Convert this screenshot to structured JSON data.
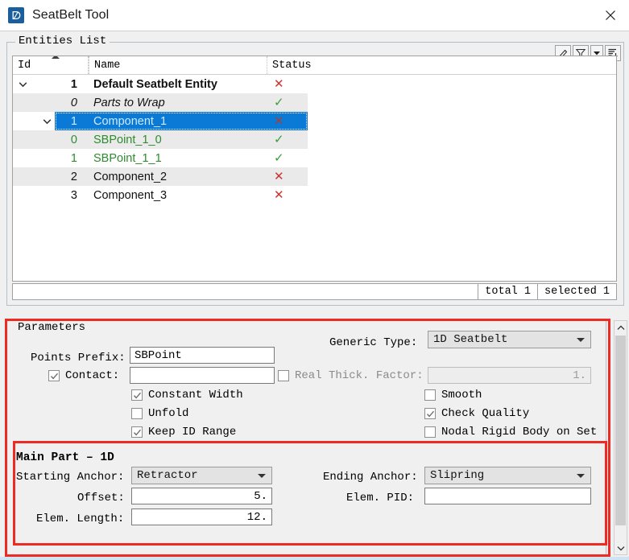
{
  "window": {
    "title": "SeatBelt Tool",
    "icon": "app-logo-icon",
    "close_label": "✕"
  },
  "entities_list": {
    "group_label": "Entities List",
    "toolbar": [
      {
        "name": "eraser-icon",
        "label": ""
      },
      {
        "name": "filter-icon",
        "label": ""
      },
      {
        "name": "filter-dropdown-icon",
        "label": ""
      },
      {
        "name": "sort-list-icon",
        "label": ""
      }
    ],
    "columns": [
      "Id",
      "Name",
      "Status"
    ],
    "rows": [
      {
        "id": "1",
        "name": "Default Seatbelt Entity",
        "status": "x",
        "level": 0,
        "expander": "down",
        "style": "bold",
        "alt": false,
        "selected": false
      },
      {
        "id": "0",
        "name": "Parts to Wrap",
        "status": "v",
        "level": 1,
        "expander": "",
        "style": "italic",
        "alt": true,
        "selected": false
      },
      {
        "id": "1",
        "name": "Component_1",
        "status": "x",
        "level": 1,
        "expander": "down",
        "style": "normal",
        "alt": false,
        "selected": true
      },
      {
        "id": "0",
        "name": "SBPoint_1_0",
        "status": "v",
        "level": 2,
        "expander": "",
        "style": "green",
        "alt": true,
        "selected": false
      },
      {
        "id": "1",
        "name": "SBPoint_1_1",
        "status": "v",
        "level": 2,
        "expander": "",
        "style": "green",
        "alt": false,
        "selected": false
      },
      {
        "id": "2",
        "name": "Component_2",
        "status": "x",
        "level": 1,
        "expander": "",
        "style": "normal",
        "alt": true,
        "selected": false
      },
      {
        "id": "3",
        "name": "Component_3",
        "status": "x",
        "level": 1,
        "expander": "",
        "style": "normal",
        "alt": false,
        "selected": false
      }
    ],
    "status_bar": {
      "total": "total 1",
      "selected": "selected 1"
    }
  },
  "parameters": {
    "group_label": "Parameters",
    "points_prefix_label": "Points Prefix:",
    "points_prefix_value": "SBPoint",
    "contact_label": "Contact:",
    "contact_checked": true,
    "contact_value": "",
    "generic_type_label": "Generic Type:",
    "generic_type_value": "1D Seatbelt",
    "real_thick_label": "Real Thick. Factor:",
    "real_thick_checked": false,
    "real_thick_value": "1.",
    "checkboxes_left": [
      {
        "label": "Constant Width",
        "checked": true
      },
      {
        "label": "Unfold",
        "checked": false
      },
      {
        "label": "Keep ID Range",
        "checked": true
      }
    ],
    "checkboxes_right": [
      {
        "label": "Smooth",
        "checked": false
      },
      {
        "label": "Check Quality",
        "checked": true
      },
      {
        "label": "Nodal Rigid Body on Set",
        "checked": false
      }
    ]
  },
  "main_part": {
    "section_title": "Main Part – 1D",
    "starting_anchor_label": "Starting Anchor:",
    "starting_anchor_value": "Retractor",
    "ending_anchor_label": "Ending Anchor:",
    "ending_anchor_value": "Slipring",
    "offset_label": "Offset:",
    "offset_value": "5.",
    "elem_pid_label": "Elem. PID:",
    "elem_pid_value": "",
    "elem_length_label": "Elem. Length:",
    "elem_length_value": "12."
  },
  "colors": {
    "accent_selection": "#0a7ad6",
    "status_error": "#cc3333",
    "status_ok": "#3a9e3a",
    "annotation": "#ee2b22",
    "title_icon": "#1b5e9e"
  }
}
